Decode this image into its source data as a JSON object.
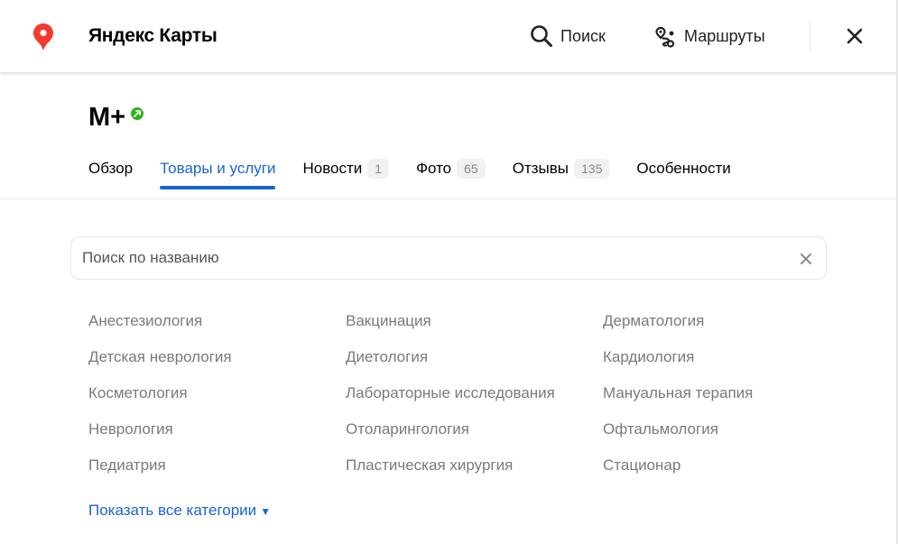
{
  "header": {
    "brand": "Яндекс Карты",
    "search_label": "Поиск",
    "routes_label": "Маршруты",
    "pin_color": "#f43a2f",
    "icons": [
      "map-pin-icon",
      "search-icon",
      "route-icon",
      "close-icon"
    ]
  },
  "org": {
    "title": "М+",
    "verified_color": "#2fb31f"
  },
  "tabs": [
    {
      "label": "Обзор",
      "badge": null,
      "active": false
    },
    {
      "label": "Товары и услуги",
      "badge": null,
      "active": true
    },
    {
      "label": "Новости",
      "badge": "1",
      "active": false
    },
    {
      "label": "Фото",
      "badge": "65",
      "active": false
    },
    {
      "label": "Отзывы",
      "badge": "135",
      "active": false
    },
    {
      "label": "Особенности",
      "badge": null,
      "active": false
    }
  ],
  "search": {
    "placeholder": "Поиск по названию",
    "value": ""
  },
  "categories": {
    "col1": [
      "Анестезиология",
      "Детская неврология",
      "Косметология",
      "Неврология",
      "Педиатрия"
    ],
    "col2": [
      "Вакцинация",
      "Диетология",
      "Лабораторные исследования",
      "Отоларингология",
      "Пластическая хирургия"
    ],
    "col3": [
      "Дерматология",
      "Кардиология",
      "Мануальная терапия",
      "Офтальмология",
      "Стационар"
    ]
  },
  "show_all": {
    "label": "Показать все категории",
    "arrow": "▼"
  },
  "colors": {
    "accent": "#1a64d6",
    "category_text": "#7a7a7a"
  }
}
